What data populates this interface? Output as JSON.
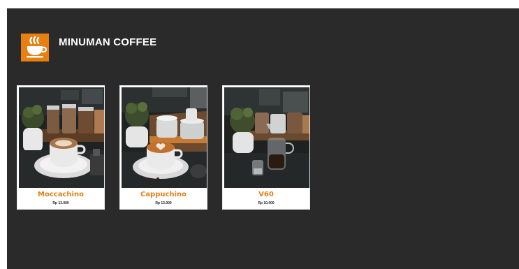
{
  "header": {
    "title": "MINUMAN COFFEE",
    "logo_icon": "coffee-cup-icon",
    "logo_color": "#e77f12"
  },
  "colors": {
    "background": "#2a2a2a",
    "accent": "#e77f12",
    "card": "#ffffff"
  },
  "products": [
    {
      "name": "Moccachino",
      "price": "Rp 13.000",
      "photo": "latte-art-cup-with-plant-photo"
    },
    {
      "name": "Cappuchino",
      "price": "Rp 13.000",
      "photo": "heart-latte-cup-with-jars-photo"
    },
    {
      "name": "V60",
      "price": "Rp 10.000",
      "photo": "v60-coffee-server-with-plant-photo"
    }
  ]
}
